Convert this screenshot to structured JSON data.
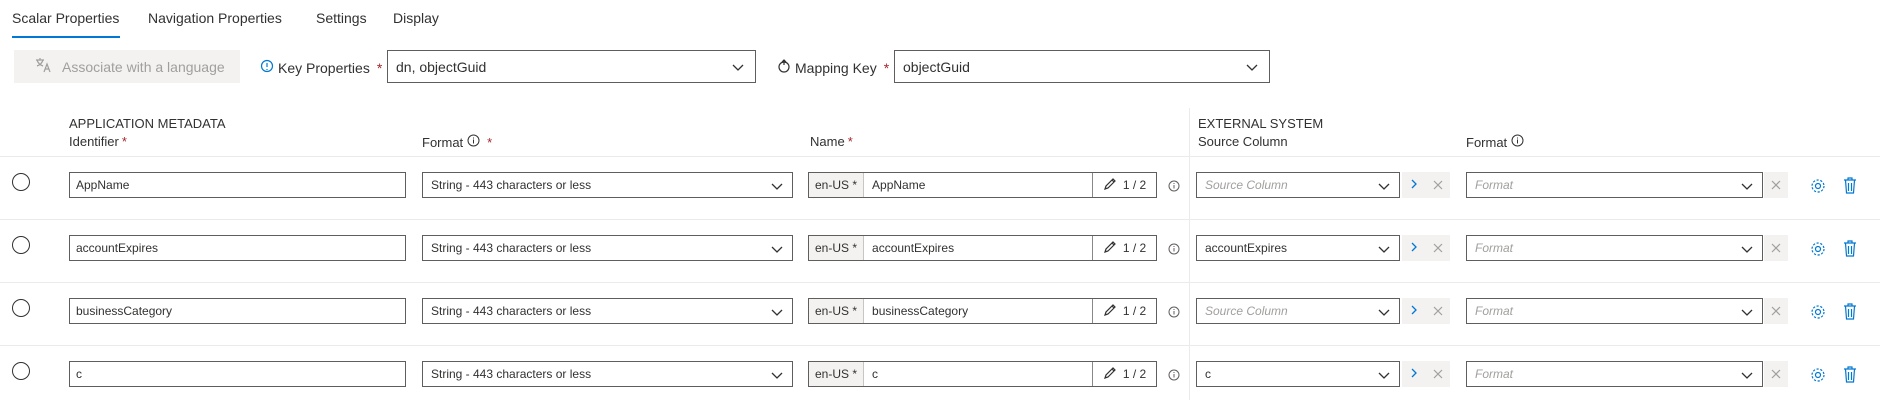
{
  "tabs": [
    {
      "label": "Scalar Properties",
      "active": true
    },
    {
      "label": "Navigation Properties",
      "active": false
    },
    {
      "label": "Settings",
      "active": false
    },
    {
      "label": "Display",
      "active": false
    }
  ],
  "toolbar": {
    "associate_button": "Associate with a language",
    "key_properties_label": "Key Properties",
    "key_properties_value": "dn, objectGuid",
    "mapping_key_label": "Mapping Key",
    "mapping_key_value": "objectGuid",
    "required_marker": "*"
  },
  "headers": {
    "app_group": "APPLICATION METADATA",
    "identifier": "Identifier",
    "format": "Format",
    "name": "Name",
    "ext_group": "EXTERNAL SYSTEM",
    "source_column": "Source Column",
    "ext_format": "Format"
  },
  "rows": [
    {
      "identifier": "AppName",
      "format": "String - 443 characters or less",
      "lang": "en-US *",
      "name": "AppName",
      "count": "1 / 2",
      "source_column": "Source Column",
      "source_is_placeholder": true,
      "ext_format": "Format"
    },
    {
      "identifier": "accountExpires",
      "format": "String - 443 characters or less",
      "lang": "en-US *",
      "name": "accountExpires",
      "count": "1 / 2",
      "source_column": "accountExpires",
      "source_is_placeholder": false,
      "ext_format": "Format"
    },
    {
      "identifier": "businessCategory",
      "format": "String - 443 characters or less",
      "lang": "en-US *",
      "name": "businessCategory",
      "count": "1 / 2",
      "source_column": "Source Column",
      "source_is_placeholder": true,
      "ext_format": "Format"
    },
    {
      "identifier": "c",
      "format": "String - 443 characters or less",
      "lang": "en-US *",
      "name": "c",
      "count": "1 / 2",
      "source_column": "c",
      "source_is_placeholder": false,
      "ext_format": "Format"
    }
  ],
  "colors": {
    "accent": "#0078d4",
    "required": "#a4262c",
    "text": "#323130",
    "disabled_bg": "#f3f2f1",
    "disabled_text": "#a19f9d"
  },
  "icons": {
    "associate": "translate-icon",
    "key_properties": "key-info-icon",
    "mapping_key": "mapping-key-icon",
    "dropdown": "chevron-down-icon",
    "info": "info-icon",
    "edit": "pencil-icon",
    "map": "chevron-right-icon",
    "clear": "close-icon",
    "settings": "gear-icon",
    "delete": "trash-icon"
  }
}
